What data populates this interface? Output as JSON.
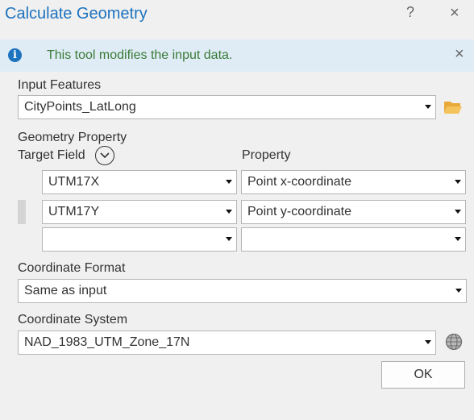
{
  "title": "Calculate Geometry",
  "titlebar": {
    "help": "?",
    "close": "×"
  },
  "info": {
    "icon": "info-icon",
    "message": "This tool modifies the input data.",
    "close": "×"
  },
  "input_features": {
    "label": "Input Features",
    "value": "CityPoints_LatLong",
    "browse_icon": "folder-icon"
  },
  "geometry_property": {
    "label": "Geometry Property",
    "target_field_label": "Target Field",
    "property_label": "Property",
    "expand_icon": "chevron-down-icon",
    "rows": [
      {
        "target_field": "UTM17X",
        "property": "Point x-coordinate"
      },
      {
        "target_field": "UTM17Y",
        "property": "Point y-coordinate"
      },
      {
        "target_field": "",
        "property": ""
      }
    ]
  },
  "coordinate_format": {
    "label": "Coordinate Format",
    "value": "Same as input"
  },
  "coordinate_system": {
    "label": "Coordinate System",
    "value": "NAD_1983_UTM_Zone_17N",
    "icon": "globe-icon"
  },
  "ok_button": "OK",
  "colors": {
    "title": "#1e73be",
    "info_bg": "#dfecf6",
    "info_text": "#3a7a36",
    "background": "#f0f0f0"
  }
}
